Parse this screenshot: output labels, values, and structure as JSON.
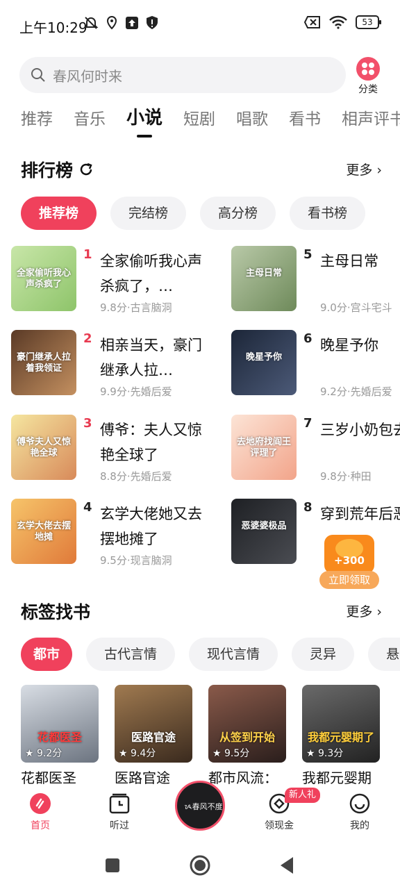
{
  "status": {
    "time": "上午10:29",
    "battery": "53"
  },
  "search": {
    "placeholder": "春风何时来",
    "category_label": "分类"
  },
  "tabs": [
    "推荐",
    "音乐",
    "小说",
    "短剧",
    "唱歌",
    "看书",
    "相声评书"
  ],
  "ranking": {
    "title": "排行榜",
    "more": "更多",
    "chips": [
      "推荐榜",
      "完结榜",
      "高分榜",
      "看书榜"
    ],
    "items": [
      {
        "rank": "1",
        "title": "全家偷听我心声杀疯了，…",
        "meta": "9.8分·古言脑洞",
        "cover_text": "全家偷听我心声杀疯了"
      },
      {
        "rank": "2",
        "title": "相亲当天，豪门继承人拉…",
        "meta": "9.9分·先婚后爱",
        "cover_text": "豪门继承人拉着我领证"
      },
      {
        "rank": "3",
        "title": "傅爷：夫人又惊艳全球了",
        "meta": "8.8分·先婚后爱",
        "cover_text": "傅爷夫人又惊艳全球"
      },
      {
        "rank": "4",
        "title": "玄学大佬她又去摆地摊了",
        "meta": "9.5分·现言脑洞",
        "cover_text": "玄学大佬去摆地摊"
      },
      {
        "rank": "5",
        "title": "主母日常",
        "meta": "9.0分·宫斗宅斗",
        "cover_text": "主母日常"
      },
      {
        "rank": "6",
        "title": "晚星予你",
        "meta": "9.2分·先婚后爱",
        "cover_text": "晚星予你"
      },
      {
        "rank": "7",
        "title": "三岁小奶包去地府找阎",
        "meta": "9.8分·种田",
        "cover_text": "去地府找阎王评理了"
      },
      {
        "rank": "8",
        "title": "穿到荒年后恶婆婆极品",
        "meta": "",
        "cover_text": "恶婆婆极品"
      }
    ]
  },
  "reward": {
    "amount": "+300",
    "label": "立即领取"
  },
  "tags": {
    "title": "标签找书",
    "more": "更多",
    "chips": [
      "都市",
      "古代言情",
      "现代言情",
      "灵异",
      "悬疑"
    ],
    "books": [
      {
        "title": "花都医圣",
        "score": "★ 9.2分",
        "cover_text": "花都医圣"
      },
      {
        "title": "医路官途",
        "score": "★ 9.4分",
        "cover_text": "医路官途"
      },
      {
        "title": "都市风流：",
        "score": "★ 9.5分",
        "cover_text": "从签到开始"
      },
      {
        "title": "我都元婴期",
        "score": "★ 9.3分",
        "cover_text": "我都元婴期了"
      }
    ]
  },
  "bottom_nav": {
    "home": "首页",
    "listened": "听过",
    "cash": "领现金",
    "new_badge": "新人礼",
    "mine": "我的",
    "disc_text": "ᝰ春风不度心"
  }
}
